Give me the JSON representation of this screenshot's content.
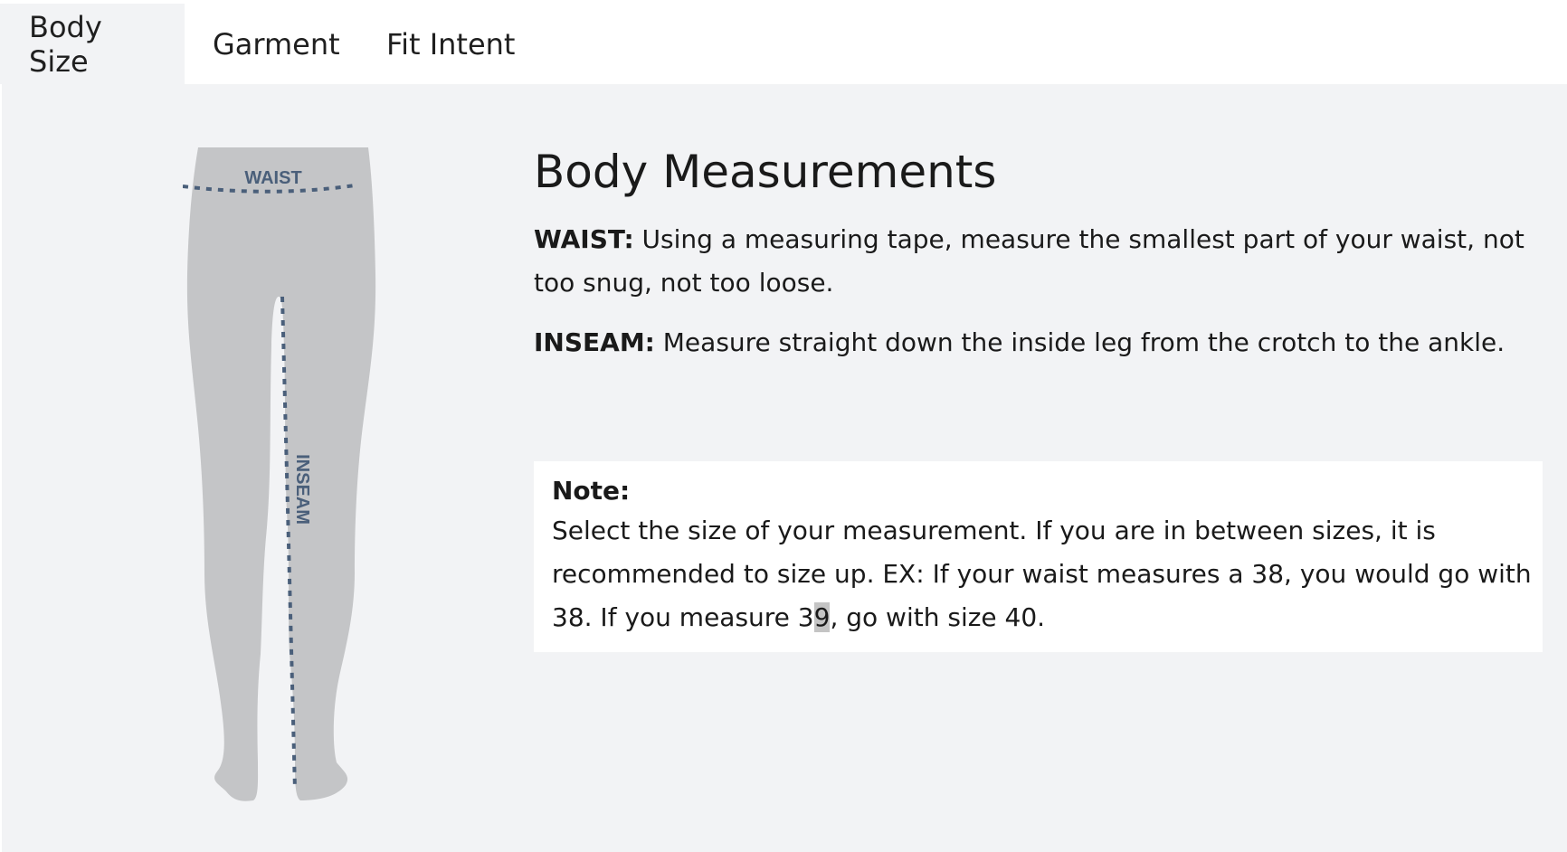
{
  "tabs": [
    {
      "label": "Body Size",
      "active": true
    },
    {
      "label": "Garment",
      "active": false
    },
    {
      "label": "Fit Intent",
      "active": false
    }
  ],
  "figure": {
    "waist_label": "WAIST",
    "inseam_label": "INSEAM"
  },
  "content": {
    "heading": "Body Measurements",
    "waist": {
      "label": "WAIST:",
      "text": " Using a measuring tape, measure the smallest part of your waist, not too snug, not too loose."
    },
    "inseam": {
      "label": "INSEAM:",
      "text": " Measure straight down the inside leg from the crotch to the ankle."
    }
  },
  "note": {
    "title": "Note:",
    "text_before": "Select the size of your measurement. If you are in between sizes, it is recommended to size up. EX: If your waist measures a 38, you would go with 38. If you measure 3",
    "highlighted": "9",
    "text_after": ", go with size 40."
  },
  "colors": {
    "panel_bg": "#f2f3f5",
    "leg_fill": "#c4c5c7",
    "measure_line": "#4a5f7a"
  }
}
